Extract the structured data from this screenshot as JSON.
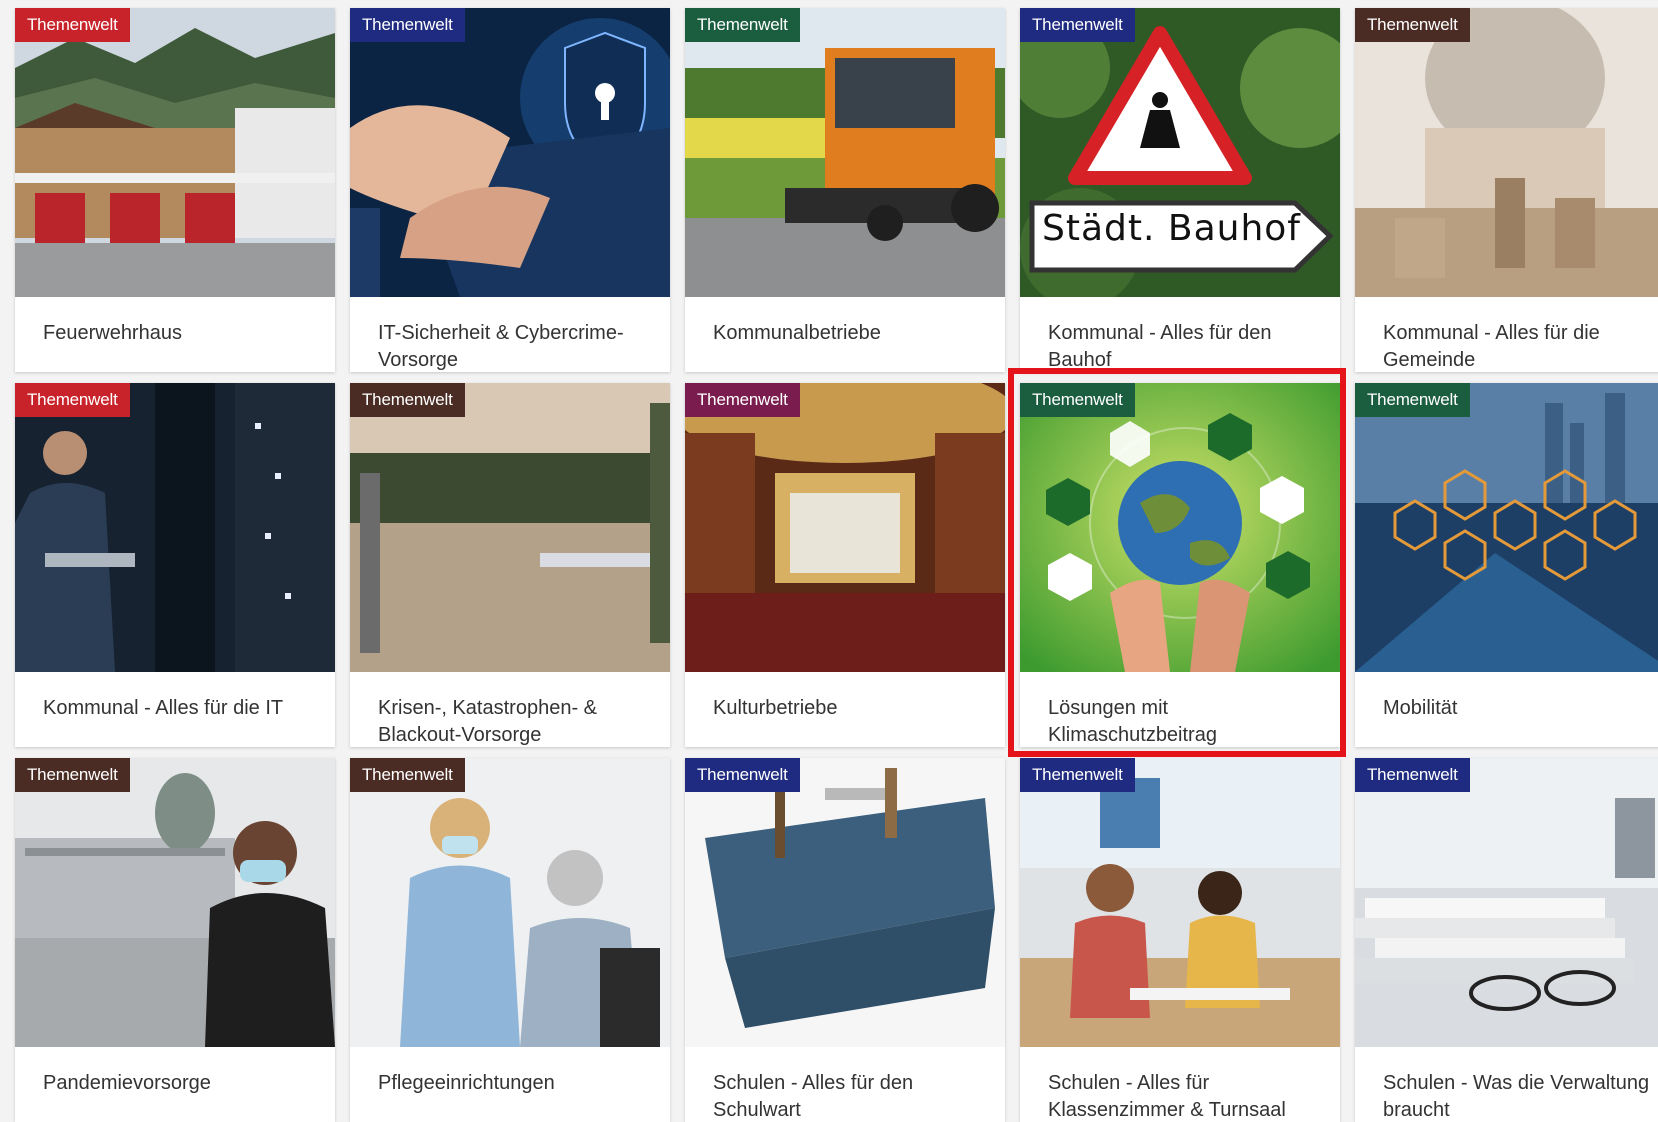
{
  "badge_label": "Themenwelt",
  "colors": {
    "badge_red": "#c8232a",
    "badge_navy": "#1f2b80",
    "badge_green": "#1b5e3f",
    "badge_brown": "#4a2c24",
    "badge_purple": "#7a1c4e",
    "highlight": "#e5141b"
  },
  "cards": [
    {
      "title": "Feuerwehrhaus",
      "badge_color": "red"
    },
    {
      "title": "IT-Sicherheit & Cybercrime-Vorsorge",
      "badge_color": "navy"
    },
    {
      "title": "Kommunalbetriebe",
      "badge_color": "green"
    },
    {
      "title": "Kommunal - Alles für den Bauhof",
      "badge_color": "navy",
      "image_sign_text": "Städt. Bauhof"
    },
    {
      "title": "Kommunal - Alles für die Gemeinde",
      "badge_color": "brown"
    },
    {
      "title": "Kommunal - Alles für die IT",
      "badge_color": "red"
    },
    {
      "title": "Krisen-, Katastrophen- & Blackout-Vorsorge",
      "badge_color": "brown"
    },
    {
      "title": "Kulturbetriebe",
      "badge_color": "purple"
    },
    {
      "title": "Lösungen mit Klimaschutzbeitrag",
      "badge_color": "green",
      "highlighted": true
    },
    {
      "title": "Mobilität",
      "badge_color": "green"
    },
    {
      "title": "Pandemievorsorge",
      "badge_color": "brown"
    },
    {
      "title": "Pflegeeinrichtungen",
      "badge_color": "brown"
    },
    {
      "title": "Schulen - Alles für den Schulwart",
      "badge_color": "navy"
    },
    {
      "title": "Schulen - Alles für Klassenzimmer & Turnsaal",
      "badge_color": "navy"
    },
    {
      "title": "Schulen - Was die Verwaltung braucht",
      "badge_color": "navy"
    }
  ]
}
